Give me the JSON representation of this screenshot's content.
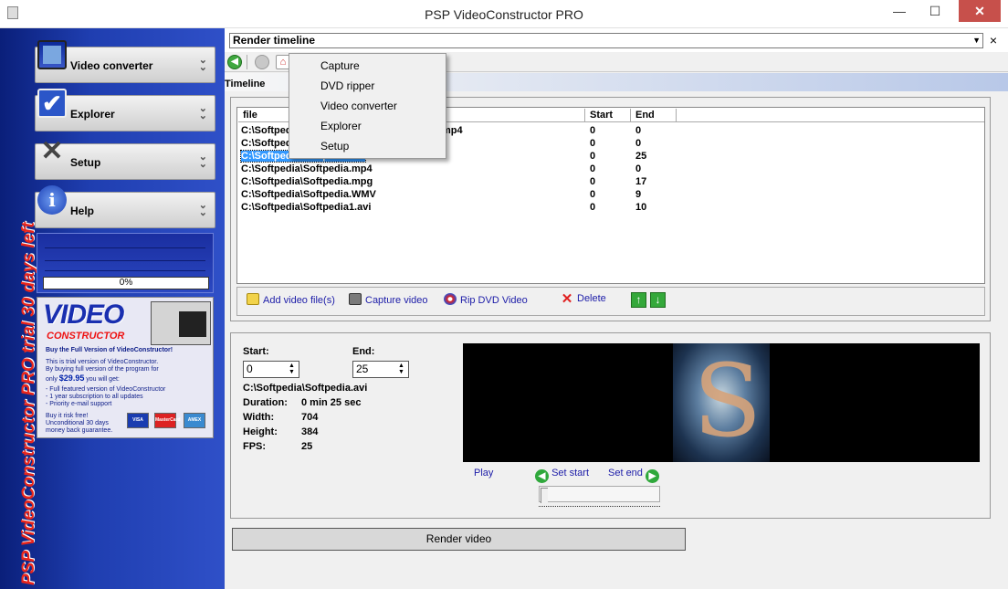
{
  "window": {
    "title": "PSP VideoConstructor PRO",
    "minimize": "—",
    "maximize": "☐",
    "close": "✕"
  },
  "sidebar": {
    "vertical_text": "PSP VideoConstructor PRO trial 30 days left",
    "items": [
      {
        "label": "Video converter",
        "icon": "film-icon"
      },
      {
        "label": "Explorer",
        "icon": "checkmark-icon"
      },
      {
        "label": "Setup",
        "icon": "tools-icon"
      },
      {
        "label": "Help",
        "icon": "info-icon"
      }
    ],
    "progress": {
      "value_percent": 0,
      "text": "0%"
    }
  },
  "ad": {
    "title": "VIDEO",
    "subtitle": "CONSTRUCTOR",
    "lines": [
      "Buy the Full Version of VideoConstructor!",
      "This is trial version of VideoConstructor.",
      "By buying full version of the program for",
      "only",
      "you will get:",
      "- Full featured version of VideoConstructor",
      "- 1 year subscription to all updates",
      "- Priority e-mail support",
      "Buy it risk free!",
      "Unconditional 30 days",
      "money back guarantee."
    ],
    "price": "$29.95",
    "cards": [
      "VISA",
      "MasterCard",
      "AMEX"
    ]
  },
  "combo": {
    "value": "Render timeline"
  },
  "menu": {
    "items": [
      "Capture",
      "DVD ripper",
      "Video converter",
      "Explorer",
      "Setup"
    ]
  },
  "tab": {
    "label": "Timeline"
  },
  "table": {
    "columns": [
      "file",
      "Start",
      "End"
    ],
    "rows": [
      {
        "file": "C:\\Softpedia\\Softpedia.mp4",
        "start": "0",
        "end": "0"
      },
      {
        "file": "C:\\Softpedia\\Softpedia.mpg",
        "start": "0",
        "end": "0"
      },
      {
        "file": "C:\\Softpedia\\Softpedia.avi",
        "start": "0",
        "end": "25",
        "selected": true
      },
      {
        "file": "C:\\Softpedia\\Softpedia.mp4",
        "start": "0",
        "end": "0"
      },
      {
        "file": "C:\\Softpedia\\Softpedia.mpg",
        "start": "0",
        "end": "17"
      },
      {
        "file": "C:\\Softpedia\\Softpedia.WMV",
        "start": "0",
        "end": "9"
      },
      {
        "file": "C:\\Softpedia\\Softpedia1.avi",
        "start": "0",
        "end": "10"
      }
    ]
  },
  "visible_cells": {
    "r0": "C:\\Softpedia",
    "r0_tail": "mp4",
    "r1": "C:\\Softped",
    "r2": "C:\\Softpedia\\Softpedia.avi"
  },
  "actions": {
    "add": "Add video file(s)",
    "capture": "Capture video",
    "rip": "Rip DVD Video",
    "delete": "Delete"
  },
  "details": {
    "start_label": "Start:",
    "start_value": "0",
    "end_label": "End:",
    "end_value": "25",
    "path": "C:\\Softpedia\\Softpedia.avi",
    "duration_label": "Duration:",
    "duration_value": "0 min 25 sec",
    "width_label": "Width:",
    "width_value": "704",
    "height_label": "Height:",
    "height_value": "384",
    "fps_label": "FPS:",
    "fps_value": "25"
  },
  "player": {
    "play": "Play",
    "set_start": "Set start",
    "set_end": "Set end"
  },
  "render": {
    "label": "Render video"
  },
  "colors": {
    "accent": "#1c1ca8",
    "selection": "#3399ff",
    "frame": "#1f3eb0",
    "trial_text": "#e8251b"
  }
}
